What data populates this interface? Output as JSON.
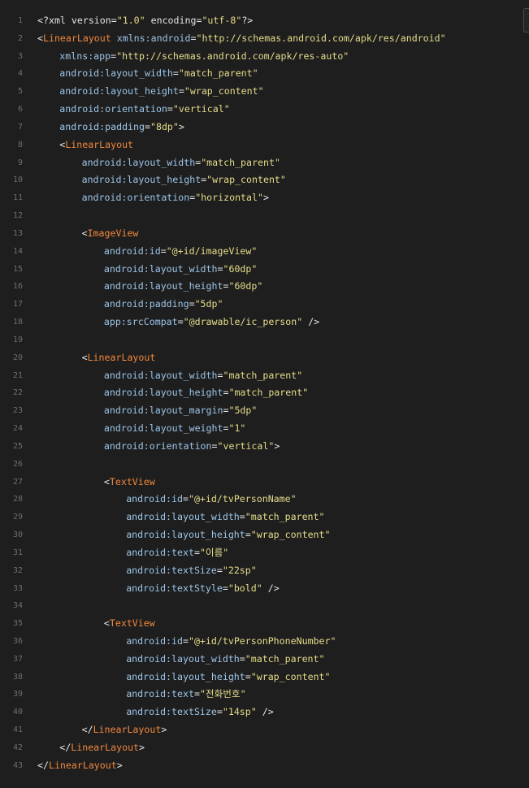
{
  "colors": {
    "background": "#1e1e1e",
    "line_number": "#6e6e6e",
    "punct": "#e6e6e6",
    "tag": "#f0883e",
    "attr": "#9cc5e8",
    "string": "#e5dc8a"
  },
  "code_lines": [
    {
      "num": "1",
      "indent": 0,
      "tokens": [
        {
          "t": "punct",
          "v": "<?xml version="
        },
        {
          "t": "str",
          "v": "\"1.0\""
        },
        {
          "t": "punct",
          "v": " encoding="
        },
        {
          "t": "str",
          "v": "\"utf-8\""
        },
        {
          "t": "punct",
          "v": "?>"
        }
      ]
    },
    {
      "num": "2",
      "indent": 0,
      "tokens": [
        {
          "t": "punct",
          "v": "<"
        },
        {
          "t": "tag",
          "v": "LinearLayout"
        },
        {
          "t": "attr",
          "v": " xmlns:android"
        },
        {
          "t": "punct",
          "v": "="
        },
        {
          "t": "str",
          "v": "\"http://schemas.android.com/apk/res/android\""
        }
      ]
    },
    {
      "num": "3",
      "indent": 1,
      "tokens": [
        {
          "t": "attr",
          "v": "xmlns:app"
        },
        {
          "t": "punct",
          "v": "="
        },
        {
          "t": "str",
          "v": "\"http://schemas.android.com/apk/res-auto\""
        }
      ]
    },
    {
      "num": "4",
      "indent": 1,
      "tokens": [
        {
          "t": "attr",
          "v": "android:layout_width"
        },
        {
          "t": "punct",
          "v": "="
        },
        {
          "t": "str",
          "v": "\"match_parent\""
        }
      ]
    },
    {
      "num": "5",
      "indent": 1,
      "tokens": [
        {
          "t": "attr",
          "v": "android:layout_height"
        },
        {
          "t": "punct",
          "v": "="
        },
        {
          "t": "str",
          "v": "\"wrap_content\""
        }
      ]
    },
    {
      "num": "6",
      "indent": 1,
      "tokens": [
        {
          "t": "attr",
          "v": "android:orientation"
        },
        {
          "t": "punct",
          "v": "="
        },
        {
          "t": "str",
          "v": "\"vertical\""
        }
      ]
    },
    {
      "num": "7",
      "indent": 1,
      "tokens": [
        {
          "t": "attr",
          "v": "android:padding"
        },
        {
          "t": "punct",
          "v": "="
        },
        {
          "t": "str",
          "v": "\"8dp\""
        },
        {
          "t": "punct",
          "v": ">"
        }
      ]
    },
    {
      "num": "8",
      "indent": 1,
      "tokens": [
        {
          "t": "punct",
          "v": "<"
        },
        {
          "t": "tag",
          "v": "LinearLayout"
        }
      ]
    },
    {
      "num": "9",
      "indent": 2,
      "tokens": [
        {
          "t": "attr",
          "v": "android:layout_width"
        },
        {
          "t": "punct",
          "v": "="
        },
        {
          "t": "str",
          "v": "\"match_parent\""
        }
      ]
    },
    {
      "num": "10",
      "indent": 2,
      "tokens": [
        {
          "t": "attr",
          "v": "android:layout_height"
        },
        {
          "t": "punct",
          "v": "="
        },
        {
          "t": "str",
          "v": "\"wrap_content\""
        }
      ]
    },
    {
      "num": "11",
      "indent": 2,
      "tokens": [
        {
          "t": "attr",
          "v": "android:orientation"
        },
        {
          "t": "punct",
          "v": "="
        },
        {
          "t": "str",
          "v": "\"horizontal\""
        },
        {
          "t": "punct",
          "v": ">"
        }
      ]
    },
    {
      "num": "12",
      "indent": 0,
      "tokens": []
    },
    {
      "num": "13",
      "indent": 2,
      "tokens": [
        {
          "t": "punct",
          "v": "<"
        },
        {
          "t": "tag",
          "v": "ImageView"
        }
      ]
    },
    {
      "num": "14",
      "indent": 3,
      "tokens": [
        {
          "t": "attr",
          "v": "android:id"
        },
        {
          "t": "punct",
          "v": "="
        },
        {
          "t": "str",
          "v": "\"@+id/imageView\""
        }
      ]
    },
    {
      "num": "15",
      "indent": 3,
      "tokens": [
        {
          "t": "attr",
          "v": "android:layout_width"
        },
        {
          "t": "punct",
          "v": "="
        },
        {
          "t": "str",
          "v": "\"60dp\""
        }
      ]
    },
    {
      "num": "16",
      "indent": 3,
      "tokens": [
        {
          "t": "attr",
          "v": "android:layout_height"
        },
        {
          "t": "punct",
          "v": "="
        },
        {
          "t": "str",
          "v": "\"60dp\""
        }
      ]
    },
    {
      "num": "17",
      "indent": 3,
      "tokens": [
        {
          "t": "attr",
          "v": "android:padding"
        },
        {
          "t": "punct",
          "v": "="
        },
        {
          "t": "str",
          "v": "\"5dp\""
        }
      ]
    },
    {
      "num": "18",
      "indent": 3,
      "tokens": [
        {
          "t": "attr",
          "v": "app:srcCompat"
        },
        {
          "t": "punct",
          "v": "="
        },
        {
          "t": "str",
          "v": "\"@drawable/ic_person\""
        },
        {
          "t": "punct",
          "v": " />"
        }
      ]
    },
    {
      "num": "19",
      "indent": 0,
      "tokens": []
    },
    {
      "num": "20",
      "indent": 2,
      "tokens": [
        {
          "t": "punct",
          "v": "<"
        },
        {
          "t": "tag",
          "v": "LinearLayout"
        }
      ]
    },
    {
      "num": "21",
      "indent": 3,
      "tokens": [
        {
          "t": "attr",
          "v": "android:layout_width"
        },
        {
          "t": "punct",
          "v": "="
        },
        {
          "t": "str",
          "v": "\"match_parent\""
        }
      ]
    },
    {
      "num": "22",
      "indent": 3,
      "tokens": [
        {
          "t": "attr",
          "v": "android:layout_height"
        },
        {
          "t": "punct",
          "v": "="
        },
        {
          "t": "str",
          "v": "\"match_parent\""
        }
      ]
    },
    {
      "num": "23",
      "indent": 3,
      "tokens": [
        {
          "t": "attr",
          "v": "android:layout_margin"
        },
        {
          "t": "punct",
          "v": "="
        },
        {
          "t": "str",
          "v": "\"5dp\""
        }
      ]
    },
    {
      "num": "24",
      "indent": 3,
      "tokens": [
        {
          "t": "attr",
          "v": "android:layout_weight"
        },
        {
          "t": "punct",
          "v": "="
        },
        {
          "t": "str",
          "v": "\"1\""
        }
      ]
    },
    {
      "num": "25",
      "indent": 3,
      "tokens": [
        {
          "t": "attr",
          "v": "android:orientation"
        },
        {
          "t": "punct",
          "v": "="
        },
        {
          "t": "str",
          "v": "\"vertical\""
        },
        {
          "t": "punct",
          "v": ">"
        }
      ]
    },
    {
      "num": "26",
      "indent": 0,
      "tokens": []
    },
    {
      "num": "27",
      "indent": 3,
      "tokens": [
        {
          "t": "punct",
          "v": "<"
        },
        {
          "t": "tag",
          "v": "TextView"
        }
      ]
    },
    {
      "num": "28",
      "indent": 4,
      "tokens": [
        {
          "t": "attr",
          "v": "android:id"
        },
        {
          "t": "punct",
          "v": "="
        },
        {
          "t": "str",
          "v": "\"@+id/tvPersonName\""
        }
      ]
    },
    {
      "num": "29",
      "indent": 4,
      "tokens": [
        {
          "t": "attr",
          "v": "android:layout_width"
        },
        {
          "t": "punct",
          "v": "="
        },
        {
          "t": "str",
          "v": "\"match_parent\""
        }
      ]
    },
    {
      "num": "30",
      "indent": 4,
      "tokens": [
        {
          "t": "attr",
          "v": "android:layout_height"
        },
        {
          "t": "punct",
          "v": "="
        },
        {
          "t": "str",
          "v": "\"wrap_content\""
        }
      ]
    },
    {
      "num": "31",
      "indent": 4,
      "tokens": [
        {
          "t": "attr",
          "v": "android:text"
        },
        {
          "t": "punct",
          "v": "="
        },
        {
          "t": "str",
          "v": "\"이름\""
        }
      ]
    },
    {
      "num": "32",
      "indent": 4,
      "tokens": [
        {
          "t": "attr",
          "v": "android:textSize"
        },
        {
          "t": "punct",
          "v": "="
        },
        {
          "t": "str",
          "v": "\"22sp\""
        }
      ]
    },
    {
      "num": "33",
      "indent": 4,
      "tokens": [
        {
          "t": "attr",
          "v": "android:textStyle"
        },
        {
          "t": "punct",
          "v": "="
        },
        {
          "t": "str",
          "v": "\"bold\""
        },
        {
          "t": "punct",
          "v": " />"
        }
      ]
    },
    {
      "num": "34",
      "indent": 0,
      "tokens": []
    },
    {
      "num": "35",
      "indent": 3,
      "tokens": [
        {
          "t": "punct",
          "v": "<"
        },
        {
          "t": "tag",
          "v": "TextView"
        }
      ]
    },
    {
      "num": "36",
      "indent": 4,
      "tokens": [
        {
          "t": "attr",
          "v": "android:id"
        },
        {
          "t": "punct",
          "v": "="
        },
        {
          "t": "str",
          "v": "\"@+id/tvPersonPhoneNumber\""
        }
      ]
    },
    {
      "num": "37",
      "indent": 4,
      "tokens": [
        {
          "t": "attr",
          "v": "android:layout_width"
        },
        {
          "t": "punct",
          "v": "="
        },
        {
          "t": "str",
          "v": "\"match_parent\""
        }
      ]
    },
    {
      "num": "38",
      "indent": 4,
      "tokens": [
        {
          "t": "attr",
          "v": "android:layout_height"
        },
        {
          "t": "punct",
          "v": "="
        },
        {
          "t": "str",
          "v": "\"wrap_content\""
        }
      ]
    },
    {
      "num": "39",
      "indent": 4,
      "tokens": [
        {
          "t": "attr",
          "v": "android:text"
        },
        {
          "t": "punct",
          "v": "="
        },
        {
          "t": "str",
          "v": "\"전화번호\""
        }
      ]
    },
    {
      "num": "40",
      "indent": 4,
      "tokens": [
        {
          "t": "attr",
          "v": "android:textSize"
        },
        {
          "t": "punct",
          "v": "="
        },
        {
          "t": "str",
          "v": "\"14sp\""
        },
        {
          "t": "punct",
          "v": " />"
        }
      ]
    },
    {
      "num": "41",
      "indent": 2,
      "tokens": [
        {
          "t": "punct",
          "v": "</"
        },
        {
          "t": "tag",
          "v": "LinearLayout"
        },
        {
          "t": "punct",
          "v": ">"
        }
      ]
    },
    {
      "num": "42",
      "indent": 1,
      "tokens": [
        {
          "t": "punct",
          "v": "</"
        },
        {
          "t": "tag",
          "v": "LinearLayout"
        },
        {
          "t": "punct",
          "v": ">"
        }
      ]
    },
    {
      "num": "43",
      "indent": 0,
      "tokens": [
        {
          "t": "punct",
          "v": "</"
        },
        {
          "t": "tag",
          "v": "LinearLayout"
        },
        {
          "t": "punct",
          "v": ">"
        }
      ]
    }
  ]
}
